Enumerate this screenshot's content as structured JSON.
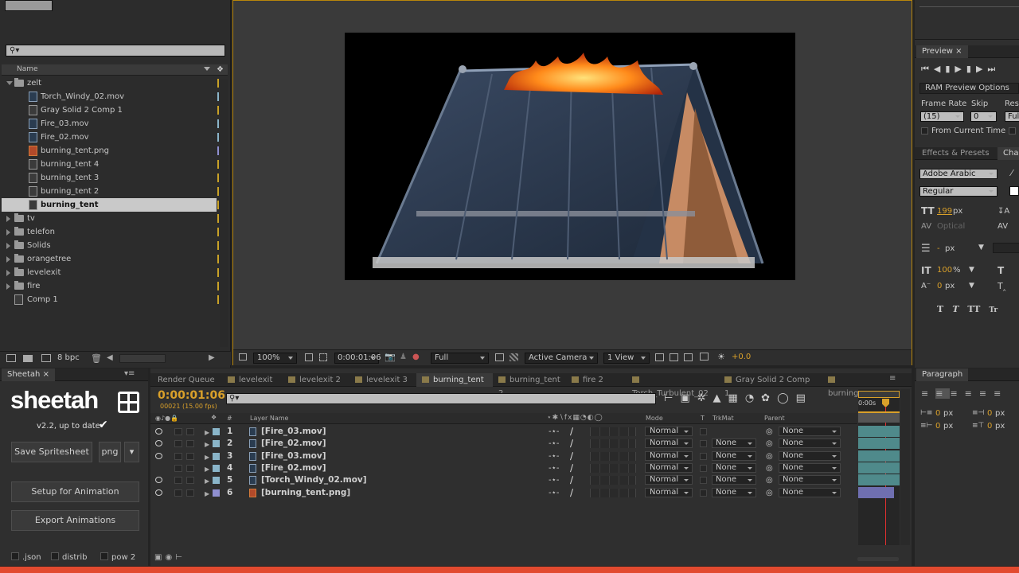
{
  "project": {
    "search_placeholder": "",
    "column_name": "Name",
    "items": [
      {
        "label": "zelt",
        "type": "folder",
        "open": true,
        "tag": "#c9a227"
      },
      {
        "label": "Torch_Windy_02.mov",
        "type": "movie",
        "tag": "#8ab5c9"
      },
      {
        "label": "Gray Solid 2 Comp 1",
        "type": "comp",
        "tag": "#c9a227"
      },
      {
        "label": "Fire_03.mov",
        "type": "movie",
        "tag": "#8ab5c9"
      },
      {
        "label": "Fire_02.mov",
        "type": "movie",
        "tag": "#8ab5c9"
      },
      {
        "label": "burning_tent.png",
        "type": "png",
        "tag": "#8f8fd0"
      },
      {
        "label": "burning_tent 4",
        "type": "comp",
        "tag": "#c9a227"
      },
      {
        "label": "burning_tent 3",
        "type": "comp",
        "tag": "#c9a227"
      },
      {
        "label": "burning_tent 2",
        "type": "comp",
        "tag": "#c9a227"
      },
      {
        "label": "burning_tent",
        "type": "comp",
        "selected": true,
        "tag": "#c9a227"
      },
      {
        "label": "tv",
        "type": "folder",
        "tag": "#c9a227"
      },
      {
        "label": "telefon",
        "type": "folder",
        "tag": "#c9a227"
      },
      {
        "label": "Solids",
        "type": "folder",
        "tag": "#c9a227"
      },
      {
        "label": "orangetree",
        "type": "folder",
        "tag": "#c9a227"
      },
      {
        "label": "levelexit",
        "type": "folder",
        "tag": "#c9a227"
      },
      {
        "label": "fire",
        "type": "folder",
        "tag": "#c9a227"
      },
      {
        "label": "Comp 1",
        "type": "comp",
        "tag": "#c9a227"
      }
    ],
    "bpc": "8 bpc"
  },
  "viewer": {
    "zoom": "100%",
    "timecode": "0:00:01:06",
    "resolution": "Full",
    "camera": "Active Camera",
    "view": "1 View",
    "exposure": "+0.0"
  },
  "preview": {
    "tab": "Preview",
    "ram_options": "RAM Preview Options",
    "frame_rate_label": "Frame Rate",
    "skip_label": "Skip",
    "res_label": "Res",
    "frame_rate": "(15)",
    "skip": "0",
    "res": "Ful",
    "from_current": "From Current Time"
  },
  "character": {
    "tab_effects": "Effects & Presets",
    "tab_char": "Cha",
    "font": "Adobe Arabic",
    "style": "Regular",
    "size": "199",
    "size_unit": "px",
    "kerning": "Optical",
    "leading": "-",
    "leading_unit": "px",
    "vscale": "100",
    "vscale_unit": "%",
    "baseline": "0",
    "baseline_unit": "px",
    "glyphs": [
      "T",
      "T",
      "TT",
      "Tr"
    ]
  },
  "sheetah": {
    "tab": "Sheetah",
    "logo": "sheetah",
    "version": "v2.2, up to date",
    "save_label": "Save Spritesheet",
    "format": "png",
    "setup_label": "Setup for Animation",
    "export_label": "Export Animations",
    "opts": [
      ".json",
      "distrib",
      "pow 2"
    ]
  },
  "timeline": {
    "tabs": [
      "Render Queue",
      "levelexit",
      "levelexit 2",
      "levelexit 3",
      "burning_tent",
      "burning_tent 2",
      "fire 2",
      "Torch_Turbulent_02",
      "Gray Solid 2 Comp 1",
      "burning_t"
    ],
    "active_tab": 4,
    "timecode": "0:00:01:06",
    "frames": "00021 (15.00 fps)",
    "col_layer": "Layer Name",
    "col_num": "#",
    "col_mode": "Mode",
    "col_t": "T",
    "col_trkmat": "TrkMat",
    "col_parent": "Parent",
    "ruler_start": "0:00s",
    "layers": [
      {
        "num": "1",
        "name": "[Fire_03.mov]",
        "mode": "Normal",
        "trkmat": "",
        "parent": "None",
        "label": "#8ab5c9",
        "visible": true
      },
      {
        "num": "2",
        "name": "[Fire_02.mov]",
        "mode": "Normal",
        "trkmat": "None",
        "parent": "None",
        "label": "#8ab5c9",
        "visible": true
      },
      {
        "num": "3",
        "name": "[Fire_03.mov]",
        "mode": "Normal",
        "trkmat": "None",
        "parent": "None",
        "label": "#8ab5c9",
        "visible": true
      },
      {
        "num": "4",
        "name": "[Fire_02.mov]",
        "mode": "Normal",
        "trkmat": "None",
        "parent": "None",
        "label": "#8ab5c9",
        "visible": false
      },
      {
        "num": "5",
        "name": "[Torch_Windy_02.mov]",
        "mode": "Normal",
        "trkmat": "None",
        "parent": "None",
        "label": "#8ab5c9",
        "visible": true
      },
      {
        "num": "6",
        "name": "[burning_tent.png]",
        "mode": "Normal",
        "trkmat": "None",
        "parent": "None",
        "label": "#8f8fd0",
        "visible": true
      }
    ]
  },
  "paragraph": {
    "tab": "Paragraph",
    "v1": "0",
    "v2": "0",
    "v3": "0",
    "v4": "0",
    "unit": "px"
  },
  "colors": {
    "accent": "#d9a02a",
    "layer_bar": "#4f8a8b",
    "png_bar": "#6f6fb0",
    "playhead": "#e03030",
    "bottom_bar": "#e24a2f"
  }
}
